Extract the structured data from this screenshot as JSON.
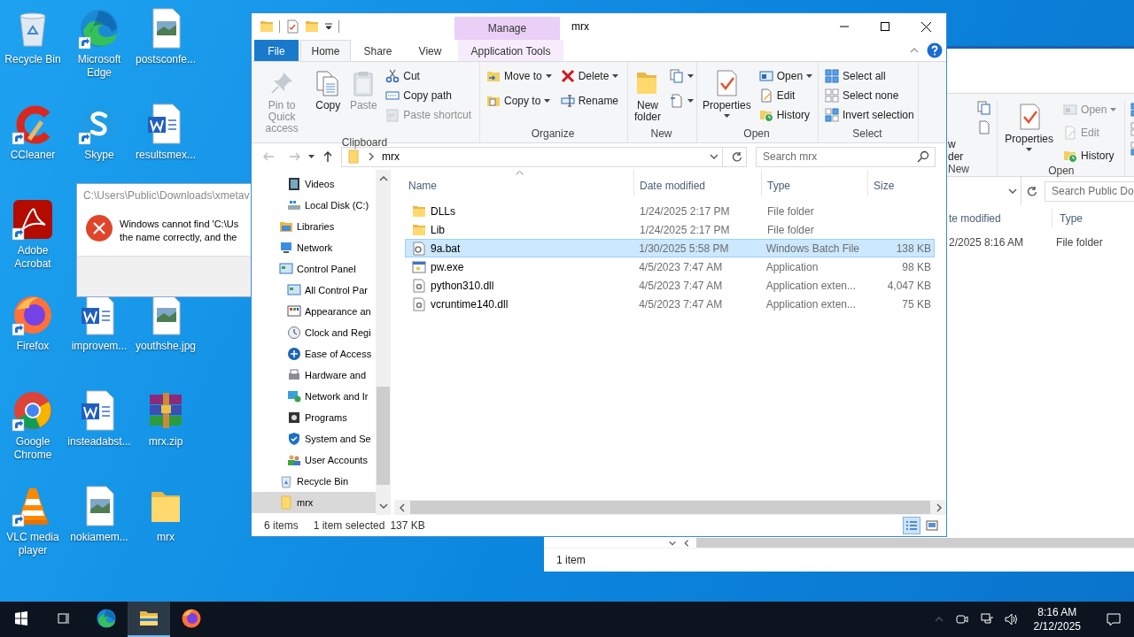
{
  "desktop": {
    "columns": [
      {
        "groups": [
          [
            {
              "label": "Recycle Bin",
              "shortcut": false
            },
            {
              "label": "CCleaner",
              "shortcut": true
            },
            {
              "label": "Adobe Acrobat",
              "shortcut": true
            },
            {
              "label": "Firefox",
              "shortcut": true
            },
            {
              "label": "Google Chrome",
              "shortcut": true
            },
            {
              "label": "VLC media player",
              "shortcut": true
            }
          ]
        ]
      },
      {
        "groups": [
          [
            {
              "label": "Microsoft Edge",
              "shortcut": true
            },
            {
              "label": "Skype",
              "shortcut": true
            }
          ],
          [
            {
              "label": "improvem...",
              "shortcut": false
            },
            {
              "label": "insteadabst...",
              "shortcut": false
            },
            {
              "label": "nokiamem...",
              "shortcut": false
            }
          ]
        ]
      },
      {
        "groups": [
          [
            {
              "label": "postsconfe...",
              "shortcut": false
            },
            {
              "label": "resultsmex...",
              "shortcut": false
            }
          ],
          [
            {
              "label": "youthshe.jpg",
              "shortcut": false
            },
            {
              "label": "mrx.zip",
              "shortcut": false
            },
            {
              "label": "mrx",
              "shortcut": false
            }
          ]
        ]
      }
    ]
  },
  "dialog": {
    "title": "C:\\Users\\Public\\Downloads\\xmetav",
    "message_lines": [
      "Windows cannot find 'C:\\Us",
      "the name correctly, and the"
    ]
  },
  "background_window": {
    "ribbon": {
      "new_group": {
        "button_fragment": [
          "w",
          "der"
        ],
        "label": "New"
      },
      "open_group": {
        "label": "Open",
        "properties": "Properties",
        "items": [
          {
            "label": "Open",
            "disabled": true,
            "dropdown": true
          },
          {
            "label": "Edit",
            "disabled": true,
            "dropdown": false
          },
          {
            "label": "History",
            "disabled": false,
            "dropdown": false
          }
        ]
      }
    },
    "search": {
      "placeholder": "Search Public Do"
    },
    "columns": [
      "te modified",
      "Type"
    ],
    "rows": [
      {
        "date": "2/2025 8:16 AM",
        "type": "File folder"
      }
    ],
    "status": "1 item"
  },
  "explorer": {
    "title": "mrx",
    "context_group": "Manage",
    "tabs": [
      {
        "label": "File",
        "kind": "file",
        "selected": false
      },
      {
        "label": "Home",
        "kind": "standard",
        "selected": true
      },
      {
        "label": "Share",
        "kind": "standard",
        "selected": false
      },
      {
        "label": "View",
        "kind": "standard",
        "selected": false
      },
      {
        "label": "Application Tools",
        "kind": "contextual",
        "selected": false
      }
    ],
    "ribbon": {
      "groups": [
        {
          "label": "Clipboard",
          "columns": [
            [
              {
                "kind": "large",
                "label": "Pin to Quick access",
                "disabled": true,
                "dropdown": false
              }
            ],
            [
              {
                "kind": "large",
                "label": "Copy",
                "disabled": false,
                "dropdown": false
              }
            ],
            [
              {
                "kind": "large",
                "label": "Paste",
                "disabled": true,
                "dropdown": false
              }
            ],
            [
              {
                "kind": "small",
                "label": "Cut",
                "disabled": false,
                "dropdown": false
              },
              {
                "kind": "small",
                "label": "Copy path",
                "disabled": false,
                "dropdown": false
              },
              {
                "kind": "small",
                "label": "Paste shortcut",
                "disabled": true,
                "dropdown": false
              }
            ]
          ]
        },
        {
          "label": "Organize",
          "columns": [
            [
              {
                "kind": "small",
                "label": "Move to",
                "disabled": false,
                "dropdown": true
              },
              {
                "kind": "small",
                "label": "Copy to",
                "disabled": false,
                "dropdown": true
              }
            ],
            [
              {
                "kind": "small",
                "label": "Delete",
                "disabled": false,
                "dropdown": true
              },
              {
                "kind": "small",
                "label": "Rename",
                "disabled": false,
                "dropdown": false
              }
            ]
          ]
        },
        {
          "label": "New",
          "columns": [
            [
              {
                "kind": "large",
                "label": "New folder",
                "disabled": false,
                "dropdown": false
              }
            ],
            [
              {
                "kind": "icon",
                "disabled": false,
                "dropdown": true
              },
              {
                "kind": "icon",
                "disabled": false,
                "dropdown": true
              }
            ]
          ]
        },
        {
          "label": "Open",
          "columns": [
            [
              {
                "kind": "large",
                "label": "Properties",
                "disabled": false,
                "dropdown": true
              }
            ],
            [
              {
                "kind": "small",
                "label": "Open",
                "disabled": false,
                "dropdown": true
              },
              {
                "kind": "small",
                "label": "Edit",
                "disabled": false,
                "dropdown": false
              },
              {
                "kind": "small",
                "label": "History",
                "disabled": false,
                "dropdown": false
              }
            ]
          ]
        },
        {
          "label": "Select",
          "columns": [
            [
              {
                "kind": "small",
                "label": "Select all",
                "disabled": false,
                "dropdown": false
              },
              {
                "kind": "small",
                "label": "Select none",
                "disabled": false,
                "dropdown": false
              },
              {
                "kind": "small",
                "label": "Invert selection",
                "disabled": false,
                "dropdown": false
              }
            ]
          ]
        }
      ]
    },
    "address": {
      "path": "mrx"
    },
    "search": {
      "placeholder": "Search mrx"
    },
    "nav_pane": {
      "items": [
        {
          "children": [
            {
              "label": "Videos",
              "selected": false
            },
            {
              "label": "Local Disk (C:)",
              "selected": false
            }
          ]
        },
        {
          "label": "Libraries",
          "selected": false
        },
        {
          "label": "Network",
          "selected": false
        },
        {
          "label": "Control Panel",
          "selected": false,
          "children": [
            {
              "label": "All Control Par",
              "selected": false
            },
            {
              "label": "Appearance an",
              "selected": false
            },
            {
              "label": "Clock and Regi",
              "selected": false
            },
            {
              "label": "Ease of Access",
              "selected": false
            },
            {
              "label": "Hardware and",
              "selected": false
            },
            {
              "label": "Network and Ir",
              "selected": false
            },
            {
              "label": "Programs",
              "selected": false
            },
            {
              "label": "System and Se",
              "selected": false
            },
            {
              "label": "User Accounts",
              "selected": false
            }
          ]
        },
        {
          "label": "Recycle Bin",
          "selected": false
        },
        {
          "label": "mrx",
          "selected": true
        }
      ]
    },
    "file_list": {
      "columns": [
        {
          "label": "Name",
          "sorted": true
        },
        {
          "label": "Date modified",
          "sorted": false
        },
        {
          "label": "Type",
          "sorted": false
        },
        {
          "label": "Size",
          "sorted": false
        }
      ],
      "rows": [
        {
          "kind": "folder",
          "name": "DLLs",
          "date": "1/24/2025 2:17 PM",
          "type": "File folder",
          "size": "",
          "selected": false
        },
        {
          "kind": "folder",
          "name": "Lib",
          "date": "1/24/2025 2:17 PM",
          "type": "File folder",
          "size": "",
          "selected": false
        },
        {
          "kind": "batch",
          "name": "9a.bat",
          "date": "1/30/2025 5:58 PM",
          "type": "Windows Batch File",
          "size": "138 KB",
          "selected": true
        },
        {
          "kind": "app",
          "name": "pw.exe",
          "date": "4/5/2023 7:47 AM",
          "type": "Application",
          "size": "98 KB",
          "selected": false
        },
        {
          "kind": "library",
          "name": "python310.dll",
          "date": "4/5/2023 7:47 AM",
          "type": "Application exten...",
          "size": "4,047 KB",
          "selected": false
        },
        {
          "kind": "library",
          "name": "vcruntime140.dll",
          "date": "4/5/2023 7:47 AM",
          "type": "Application exten...",
          "size": "75 KB",
          "selected": false
        }
      ]
    },
    "status_bar": {
      "item_count": "6 items",
      "selection": "1 item selected",
      "selection_size": "137 KB",
      "views": [
        {
          "selected": true
        },
        {
          "selected": false
        }
      ]
    }
  },
  "taskbar": {
    "apps": [
      {
        "active": false
      },
      {
        "active": true
      },
      {
        "active": false
      }
    ],
    "time": "8:16 AM",
    "date": "2/12/2025"
  }
}
